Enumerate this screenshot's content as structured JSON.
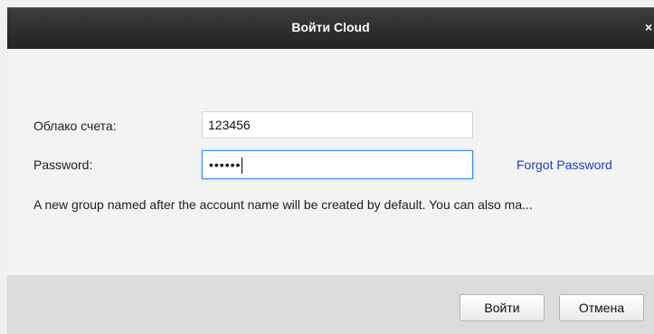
{
  "window": {
    "title": "Войти Cloud",
    "close_symbol": "×"
  },
  "form": {
    "account_label": "Облако счета:",
    "account_value": "123456",
    "password_label": "Password:",
    "password_value": "••••••",
    "forgot_password": "Forgot Password",
    "notice": "A new group named after the account name will be created  by default. You can also ma..."
  },
  "buttons": {
    "login": "Войти",
    "cancel": "Отмена"
  },
  "icons": {
    "close": "close-icon"
  },
  "colors": {
    "titlebar": "#2b2b2b",
    "link": "#1f3fbf",
    "focus": "#3a8ee6",
    "footer": "#dcdcdc"
  }
}
